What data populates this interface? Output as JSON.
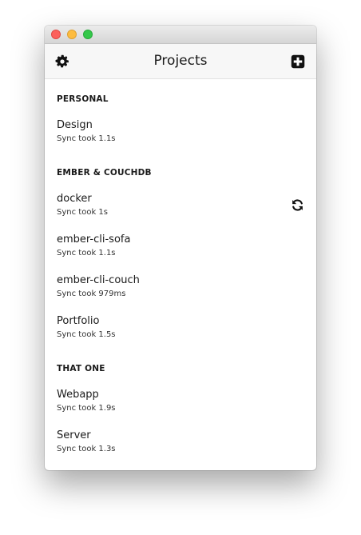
{
  "toolbar": {
    "title": "Projects",
    "settings_icon": "gear-icon",
    "add_icon": "plus-square-icon"
  },
  "sections": [
    {
      "title": "PERSONAL",
      "projects": [
        {
          "name": "Design",
          "sync": "Sync took 1.1s"
        }
      ]
    },
    {
      "title": "EMBER & COUCHDB",
      "projects": [
        {
          "name": "docker",
          "sync": "Sync took 1s",
          "syncing_icon": "refresh-icon"
        },
        {
          "name": "ember-cli-sofa",
          "sync": "Sync took 1.1s"
        },
        {
          "name": "ember-cli-couch",
          "sync": "Sync took 979ms"
        },
        {
          "name": "Portfolio",
          "sync": "Sync took 1.5s"
        }
      ]
    },
    {
      "title": "THAT ONE",
      "projects": [
        {
          "name": "Webapp",
          "sync": "Sync took 1.9s"
        },
        {
          "name": "Server",
          "sync": "Sync took 1.3s"
        }
      ]
    }
  ]
}
